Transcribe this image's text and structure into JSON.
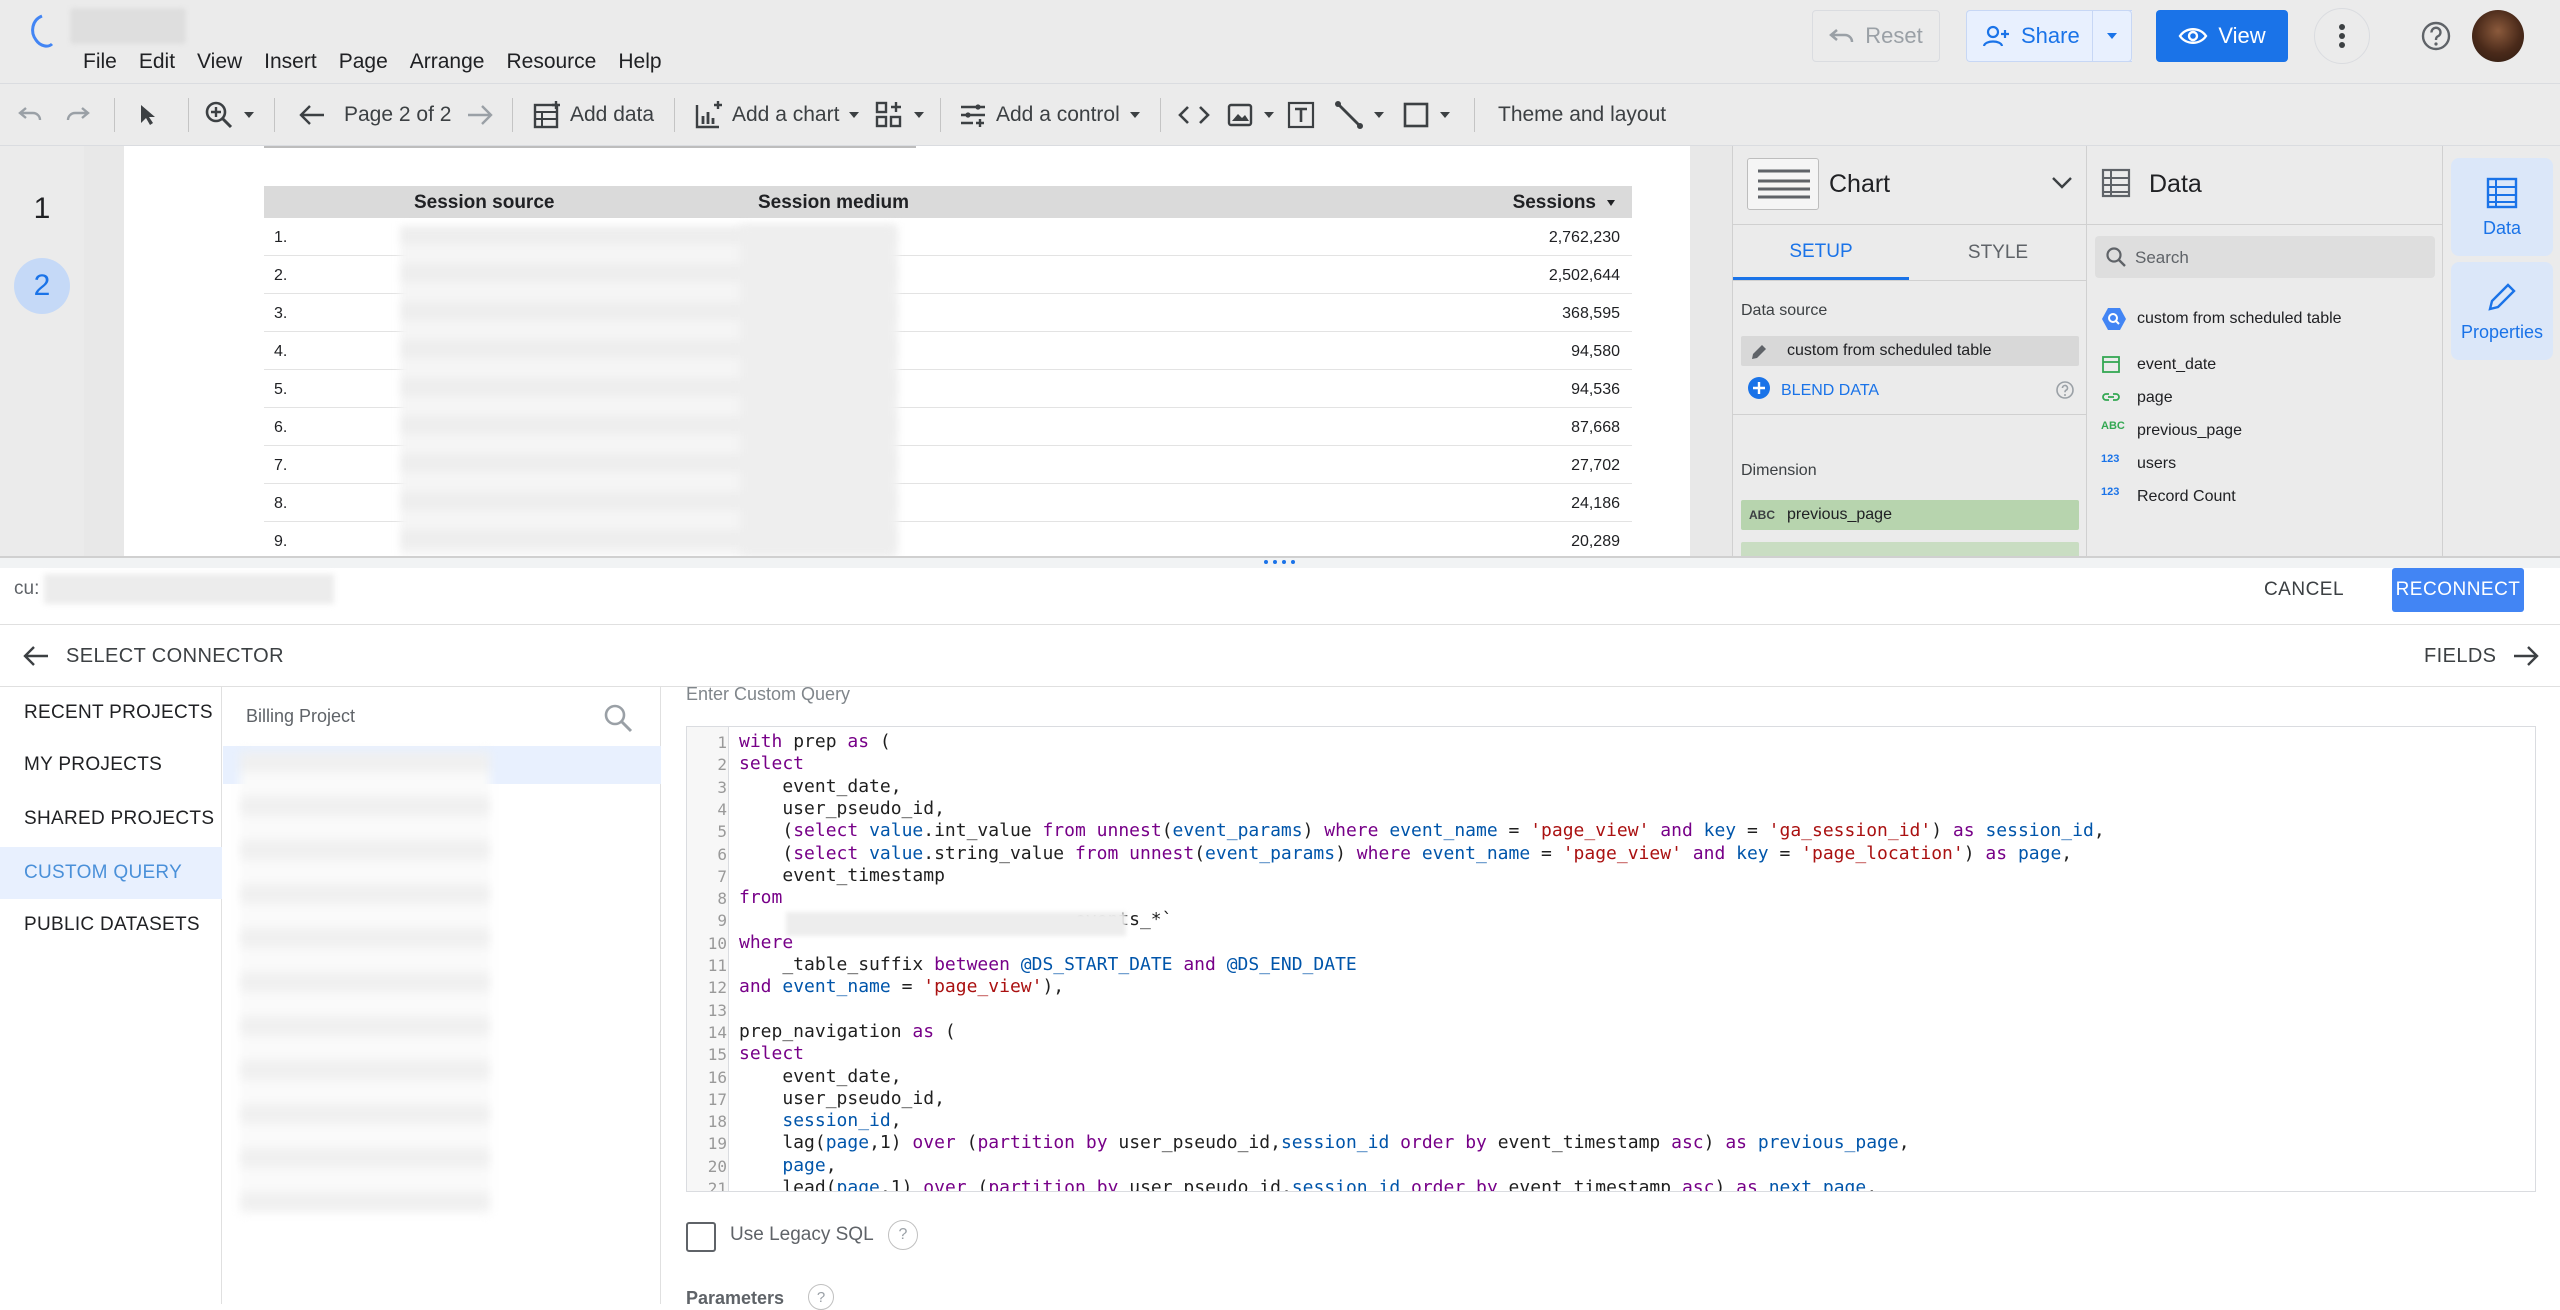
{
  "menu": [
    "File",
    "Edit",
    "View",
    "Insert",
    "Page",
    "Arrange",
    "Resource",
    "Help"
  ],
  "header": {
    "reset": "Reset",
    "share": "Share",
    "view": "View"
  },
  "toolbar": {
    "page_indicator": "Page 2 of 2",
    "add_data": "Add data",
    "add_chart": "Add a chart",
    "add_control": "Add a control",
    "theme": "Theme and layout"
  },
  "pages": [
    "1",
    "2"
  ],
  "table": {
    "headers": [
      "Session source",
      "Session medium",
      "Sessions"
    ],
    "rows": [
      {
        "idx": "1.",
        "sessions": "2,762,230"
      },
      {
        "idx": "2.",
        "sessions": "2,502,644"
      },
      {
        "idx": "3.",
        "sessions": "368,595"
      },
      {
        "idx": "4.",
        "sessions": "94,580"
      },
      {
        "idx": "5.",
        "sessions": "94,536"
      },
      {
        "idx": "6.",
        "sessions": "87,668"
      },
      {
        "idx": "7.",
        "sessions": "27,702"
      },
      {
        "idx": "8.",
        "sessions": "24,186"
      },
      {
        "idx": "9.",
        "sessions": "20,289"
      }
    ]
  },
  "chart_panel": {
    "title": "Chart",
    "tab_setup": "SETUP",
    "tab_style": "STYLE",
    "data_source_label": "Data source",
    "data_source": "custom from scheduled table",
    "blend": "BLEND DATA",
    "dimension_label": "Dimension",
    "dimension": "previous_page"
  },
  "data_panel": {
    "title": "Data",
    "search_placeholder": "Search",
    "source": "custom from scheduled table",
    "fields": [
      {
        "type": "date",
        "name": "event_date"
      },
      {
        "type": "link",
        "name": "page"
      },
      {
        "type": "ABC",
        "name": "previous_page"
      },
      {
        "type": "123",
        "name": "users"
      },
      {
        "type": "123",
        "name": "Record Count"
      }
    ]
  },
  "rail": {
    "data": "Data",
    "properties": "Properties"
  },
  "editor": {
    "ds_prefix": "cu:",
    "cancel": "CANCEL",
    "reconnect": "RECONNECT",
    "select_connector": "SELECT CONNECTOR",
    "fields": "FIELDS",
    "nav": [
      "RECENT PROJECTS",
      "MY PROJECTS",
      "SHARED PROJECTS",
      "CUSTOM QUERY",
      "PUBLIC DATASETS"
    ],
    "active_nav": "CUSTOM QUERY",
    "billing_label": "Billing Project",
    "custom_query_label": "Enter Custom Query",
    "legacy_sql": "Use Legacy SQL",
    "parameters": "Parameters",
    "help_glyph": "?"
  },
  "sql_lines": [
    "with prep as (",
    "select",
    "    event_date,",
    "    user_pseudo_id,",
    "    (select value.int_value from unnest(event_params) where event_name = 'page_view' and key = 'ga_session_id') as session_id,",
    "    (select value.string_value from unnest(event_params) where event_name = 'page_view' and key = 'page_location') as page,",
    "    event_timestamp",
    "from",
    "                              .events_*`",
    "where",
    "    _table_suffix between @DS_START_DATE and @DS_END_DATE",
    "and event_name = 'page_view'),",
    "",
    "prep_navigation as (",
    "select",
    "    event_date,",
    "    user_pseudo_id,",
    "    session_id,",
    "    lag(page,1) over (partition by user_pseudo_id,session_id order by event_timestamp asc) as previous_page,",
    "    page,",
    "    lead(page,1) over (partition by user_pseudo_id,session_id order by event_timestamp asc) as next_page,"
  ],
  "colors": {
    "accent": "#1a73e8",
    "keyword": "#770088",
    "string": "#aa1111",
    "variable": "#0055aa"
  }
}
